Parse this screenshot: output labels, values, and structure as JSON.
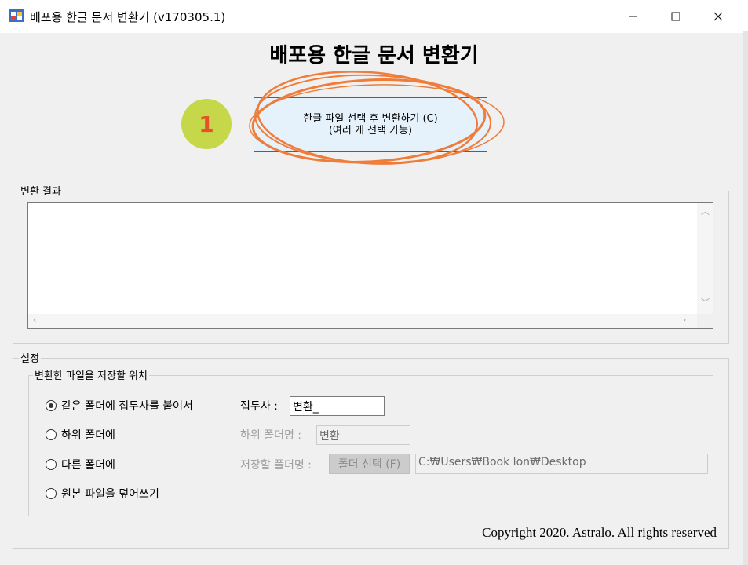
{
  "window": {
    "title": "배포용 한글 문서 변환기 (v170305.1)",
    "minimize_label": "—",
    "maximize_label": "☐",
    "close_label": "✕"
  },
  "header": {
    "main_title": "배포용 한글 문서 변환기"
  },
  "convert_button": {
    "line1": "한글 파일 선택 후 변환하기 (C)",
    "line2": "(여러 개 선택 가능)"
  },
  "annotation": {
    "badge_number": "1",
    "color": "#f07c3a",
    "badge_color": "#c6d84a"
  },
  "result_group": {
    "label": "변환 결과"
  },
  "settings": {
    "label": "설정",
    "location_group_label": "변환한 파일을 저장할 위치",
    "options": [
      {
        "label": "같은 폴더에 접두사를 붙여서",
        "selected": true
      },
      {
        "label": "하위 폴더에",
        "selected": false
      },
      {
        "label": "다른 폴더에",
        "selected": false
      },
      {
        "label": "원본 파일을 덮어쓰기",
        "selected": false
      }
    ],
    "prefix_label": "접두사 :",
    "prefix_value": "변환_",
    "subfolder_label": "하위 폴더명 :",
    "subfolder_value": "변환",
    "save_folder_label": "저장할 폴더명 :",
    "select_folder_button": "폴더 선택 (F)",
    "save_folder_path": "C:₩Users₩Book lon₩Desktop"
  },
  "footer": {
    "copyright": "Copyright 2020. Astralo. All rights reserved"
  }
}
